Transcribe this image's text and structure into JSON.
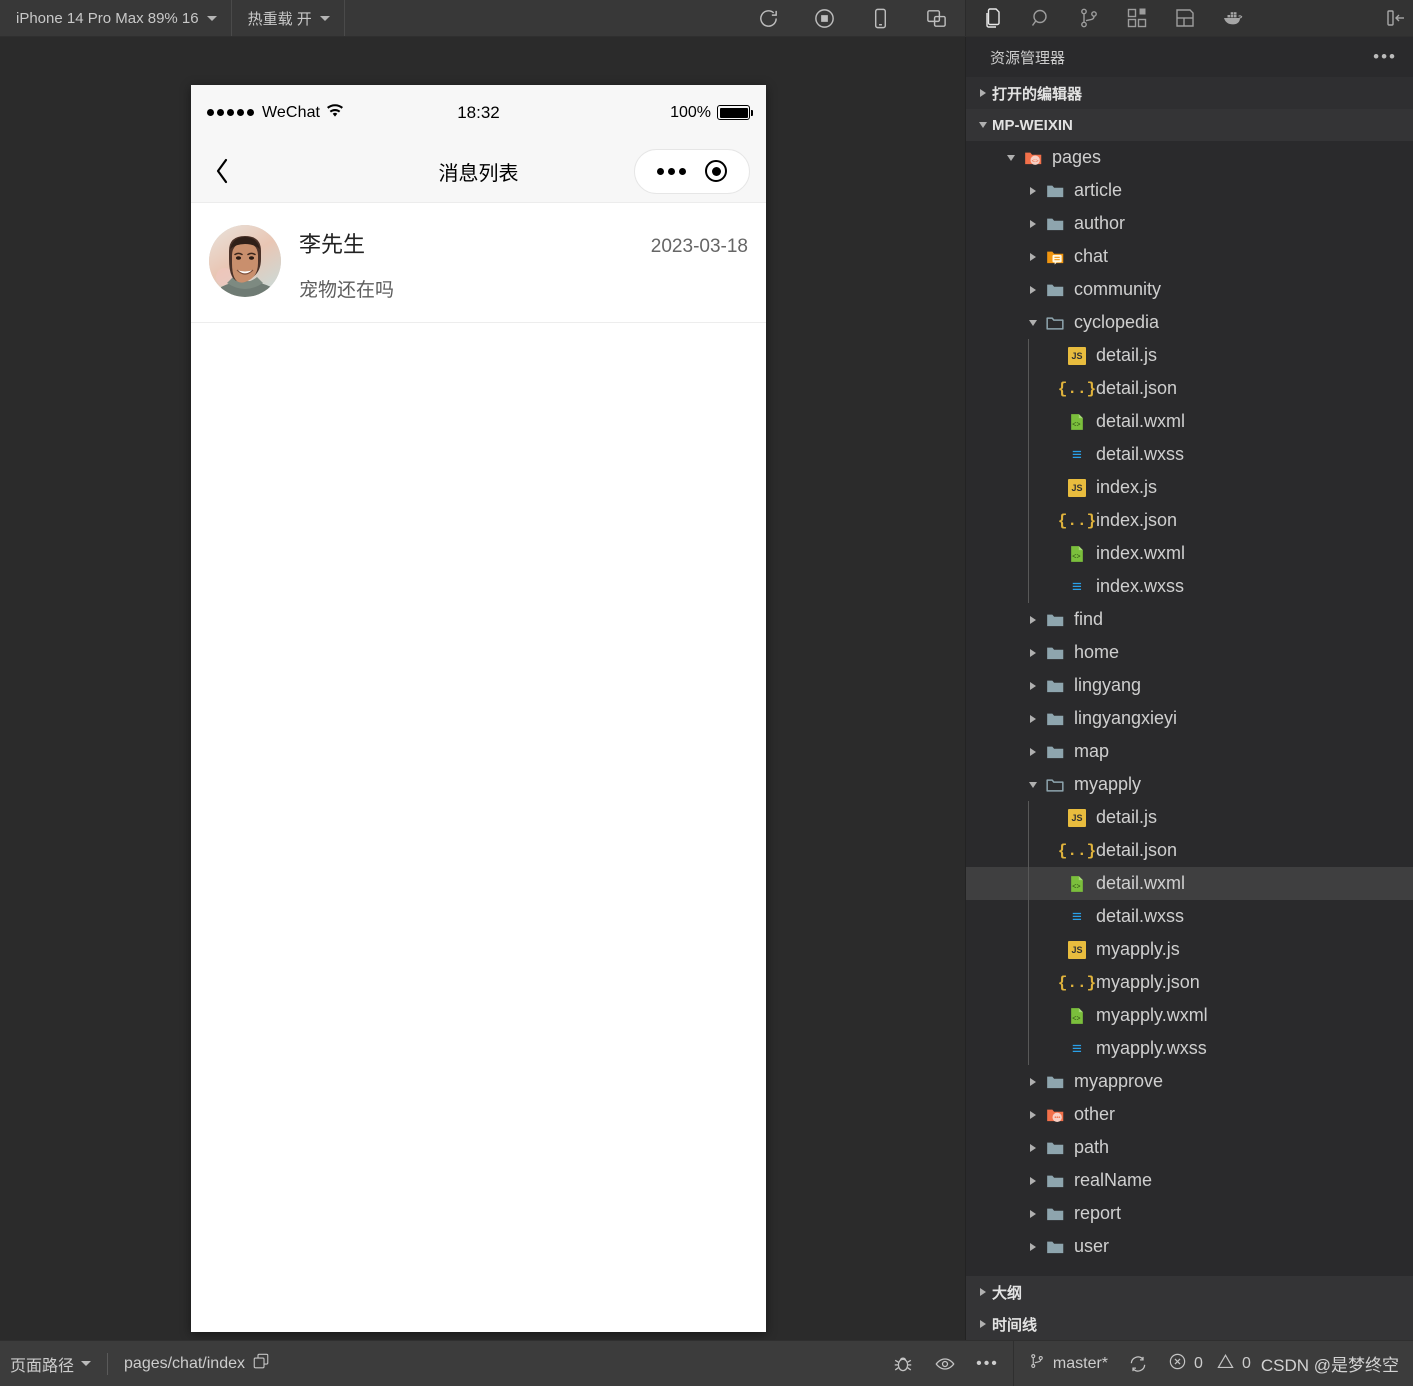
{
  "toolbar": {
    "device_select": "iPhone 14 Pro Max 89% 16",
    "hotreload_select": "热重载 开",
    "icons": [
      {
        "name": "refresh-icon"
      },
      {
        "name": "stop-record-icon"
      },
      {
        "name": "mobile-preview-icon"
      },
      {
        "name": "multi-window-icon"
      }
    ]
  },
  "activitybar": {
    "items": [
      {
        "name": "explorer-icon",
        "active": true
      },
      {
        "name": "search-icon",
        "active": false
      },
      {
        "name": "source-control-icon",
        "active": false
      },
      {
        "name": "extensions-icon",
        "active": false
      },
      {
        "name": "layout-icon",
        "active": false
      },
      {
        "name": "docker-icon",
        "active": false
      }
    ],
    "toggle_panel": "toggle-sidebar-icon"
  },
  "simulator": {
    "statusbar": {
      "carrier": "WeChat",
      "time": "18:32",
      "battery_percent": "100%"
    },
    "navbar": {
      "title": "消息列表",
      "back": "back-chevron-icon"
    },
    "messages": [
      {
        "name": "李先生",
        "date": "2023-03-18",
        "preview": "宠物还在吗"
      }
    ]
  },
  "explorer": {
    "title": "资源管理器",
    "more_actions": "•••",
    "sections": [
      {
        "label": "打开的编辑器",
        "expanded": false
      },
      {
        "label": "MP-WEIXIN",
        "expanded": true
      }
    ],
    "footer_sections": [
      {
        "label": "大纲",
        "expanded": false
      },
      {
        "label": "时间线",
        "expanded": false
      }
    ],
    "tree": [
      {
        "label": "pages",
        "depth": 1,
        "type": "folder-special-pages",
        "state": "open",
        "selected": false
      },
      {
        "label": "article",
        "depth": 2,
        "type": "folder",
        "state": "closed",
        "selected": false
      },
      {
        "label": "author",
        "depth": 2,
        "type": "folder",
        "state": "closed",
        "selected": false
      },
      {
        "label": "chat",
        "depth": 2,
        "type": "folder-special-chat",
        "state": "closed",
        "selected": false
      },
      {
        "label": "community",
        "depth": 2,
        "type": "folder",
        "state": "closed",
        "selected": false
      },
      {
        "label": "cyclopedia",
        "depth": 2,
        "type": "folder",
        "state": "open",
        "selected": false
      },
      {
        "label": "detail.js",
        "depth": 3,
        "type": "js",
        "state": "file",
        "selected": false
      },
      {
        "label": "detail.json",
        "depth": 3,
        "type": "json",
        "state": "file",
        "selected": false
      },
      {
        "label": "detail.wxml",
        "depth": 3,
        "type": "wxml",
        "state": "file",
        "selected": false
      },
      {
        "label": "detail.wxss",
        "depth": 3,
        "type": "wxss",
        "state": "file",
        "selected": false
      },
      {
        "label": "index.js",
        "depth": 3,
        "type": "js",
        "state": "file",
        "selected": false
      },
      {
        "label": "index.json",
        "depth": 3,
        "type": "json",
        "state": "file",
        "selected": false
      },
      {
        "label": "index.wxml",
        "depth": 3,
        "type": "wxml",
        "state": "file",
        "selected": false
      },
      {
        "label": "index.wxss",
        "depth": 3,
        "type": "wxss",
        "state": "file",
        "selected": false
      },
      {
        "label": "find",
        "depth": 2,
        "type": "folder",
        "state": "closed",
        "selected": false
      },
      {
        "label": "home",
        "depth": 2,
        "type": "folder",
        "state": "closed",
        "selected": false
      },
      {
        "label": "lingyang",
        "depth": 2,
        "type": "folder",
        "state": "closed",
        "selected": false
      },
      {
        "label": "lingyangxieyi",
        "depth": 2,
        "type": "folder",
        "state": "closed",
        "selected": false
      },
      {
        "label": "map",
        "depth": 2,
        "type": "folder",
        "state": "closed",
        "selected": false
      },
      {
        "label": "myapply",
        "depth": 2,
        "type": "folder",
        "state": "open",
        "selected": false
      },
      {
        "label": "detail.js",
        "depth": 3,
        "type": "js",
        "state": "file",
        "selected": false
      },
      {
        "label": "detail.json",
        "depth": 3,
        "type": "json",
        "state": "file",
        "selected": false
      },
      {
        "label": "detail.wxml",
        "depth": 3,
        "type": "wxml",
        "state": "file",
        "selected": true
      },
      {
        "label": "detail.wxss",
        "depth": 3,
        "type": "wxss",
        "state": "file",
        "selected": false
      },
      {
        "label": "myapply.js",
        "depth": 3,
        "type": "js",
        "state": "file",
        "selected": false
      },
      {
        "label": "myapply.json",
        "depth": 3,
        "type": "json",
        "state": "file",
        "selected": false
      },
      {
        "label": "myapply.wxml",
        "depth": 3,
        "type": "wxml",
        "state": "file",
        "selected": false
      },
      {
        "label": "myapply.wxss",
        "depth": 3,
        "type": "wxss",
        "state": "file",
        "selected": false
      },
      {
        "label": "myapprove",
        "depth": 2,
        "type": "folder",
        "state": "closed",
        "selected": false
      },
      {
        "label": "other",
        "depth": 2,
        "type": "folder-special-other",
        "state": "closed",
        "selected": false
      },
      {
        "label": "path",
        "depth": 2,
        "type": "folder",
        "state": "closed",
        "selected": false
      },
      {
        "label": "realName",
        "depth": 2,
        "type": "folder",
        "state": "closed",
        "selected": false
      },
      {
        "label": "report",
        "depth": 2,
        "type": "folder",
        "state": "closed",
        "selected": false
      },
      {
        "label": "user",
        "depth": 2,
        "type": "folder",
        "state": "closed",
        "selected": false
      }
    ]
  },
  "statusbar": {
    "page_path_label": "页面路径",
    "page_path_value": "pages/chat/index",
    "copy_icon": "copy-icon",
    "debug_icon": "bug-icon",
    "eye_icon": "eye-icon",
    "more_icon": "•••",
    "branch": "master*",
    "sync_icon": "sync-icon",
    "errors": "0",
    "warnings": "0",
    "watermark": "CSDN @是梦终空"
  },
  "colors": {
    "accent_orange": "#f2704a",
    "js_yellow": "#e8bc3e",
    "json_yellow": "#e0b33c",
    "wxml_green": "#7bbf3c",
    "wxss_blue": "#29a0e8",
    "folder_blue": "#8ea5ae",
    "selection_bg": "#3f3f40",
    "sidebar_bg": "#2a2a2c",
    "topbar_bg": "#383838",
    "statusbar_bg": "#3c3c3c"
  }
}
